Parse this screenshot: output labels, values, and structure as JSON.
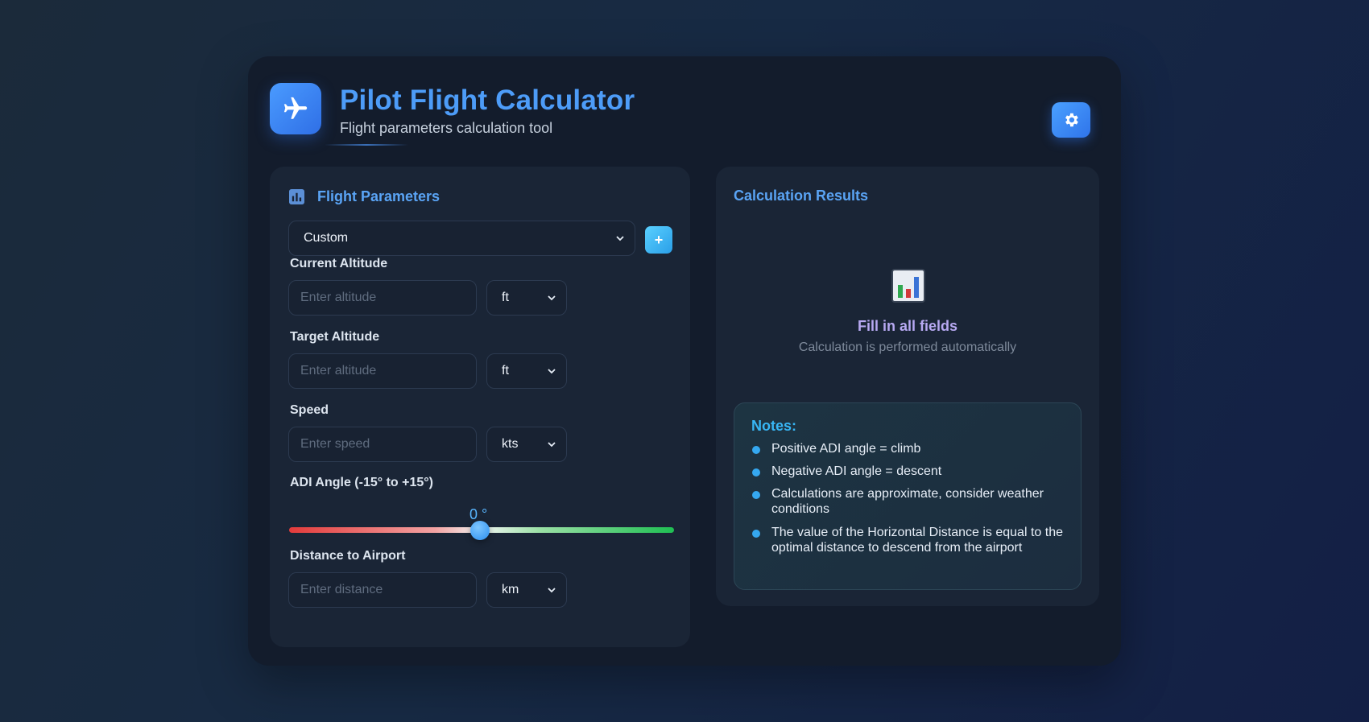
{
  "header": {
    "title": "Pilot Flight Calculator",
    "subtitle": "Flight parameters calculation tool",
    "logo_icon": "airplane-icon",
    "settings_icon": "gear-icon"
  },
  "parameters": {
    "title": "Flight Parameters",
    "preset": {
      "selected": "Custom"
    },
    "add_label": "+",
    "fields": {
      "current_altitude": {
        "label": "Current Altitude",
        "placeholder": "Enter altitude",
        "unit": "ft"
      },
      "target_altitude": {
        "label": "Target Altitude",
        "placeholder": "Enter altitude",
        "unit": "ft"
      },
      "speed": {
        "label": "Speed",
        "placeholder": "Enter speed",
        "unit": "kts"
      },
      "adi_angle": {
        "label": "ADI Angle (-15° to +15°)",
        "value": 0,
        "value_text": "0 °",
        "min": -15,
        "max": 15
      },
      "distance": {
        "label": "Distance to Airport",
        "placeholder": "Enter distance",
        "unit": "km"
      }
    }
  },
  "results": {
    "title": "Calculation Results",
    "empty_title": "Fill in all fields",
    "empty_subtitle": "Calculation is performed automatically",
    "empty_icon": "bar-chart-icon",
    "notes": {
      "title": "Notes:",
      "items": [
        "Positive ADI angle = climb",
        "Negative ADI angle = descent",
        "Calculations are approximate, consider weather conditions",
        "The value of the Horizontal Distance is equal to the optimal distance to descend from the airport"
      ]
    }
  },
  "colors": {
    "accent": "#4d9cf8",
    "panel": "#1a2536",
    "card": "#131c2c",
    "note_accent": "#38b6f5"
  }
}
